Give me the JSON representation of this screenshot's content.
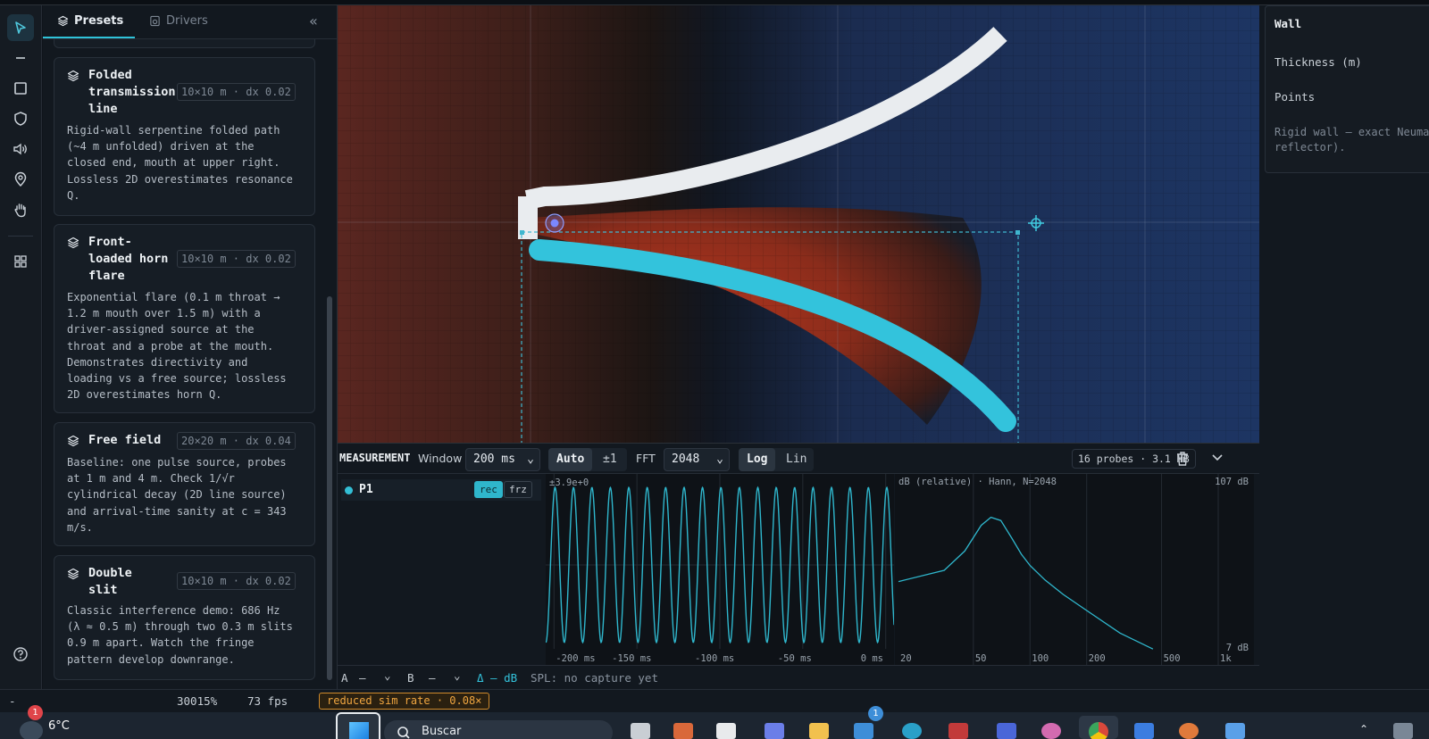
{
  "presets_panel": {
    "tabs": [
      {
        "label": "Presets"
      },
      {
        "label": "Drivers"
      }
    ],
    "collapse_glyph": "«",
    "cards": [
      {
        "name_lines": [
          "Folded",
          "transmission",
          "line"
        ],
        "meta": "10×10 m · dx 0.02",
        "desc_lines": [
          "Rigid-wall serpentine folded path",
          "(~4 m unfolded) driven at the",
          "closed end, mouth at upper right.",
          "Lossless 2D overestimates resonance",
          "Q."
        ]
      },
      {
        "name_lines": [
          "Front-",
          "loaded horn",
          "flare"
        ],
        "meta": "10×10 m · dx 0.02",
        "desc_lines": [
          "Exponential flare (0.1 m throat →",
          "1.2 m mouth over 1.5 m) with a",
          "driver-assigned source at the",
          "throat and a probe at the mouth.",
          "Demonstrates directivity and",
          "loading vs a free source; lossless",
          "2D overestimates horn Q."
        ]
      },
      {
        "name_lines": [
          "Free field"
        ],
        "meta": "20×20 m · dx 0.04",
        "desc_lines": [
          "Baseline: one pulse source, probes",
          "at 1 m and 4 m. Check 1/√r",
          "cylindrical decay (2D line source)",
          "and arrival-time sanity at c = 343",
          "m/s."
        ]
      },
      {
        "name_lines": [
          "Double",
          "slit"
        ],
        "meta": "10×10 m · dx 0.02",
        "desc_lines": [
          "Classic interference demo: 686 Hz",
          "(λ ≈ 0.5 m) through two 0.3 m slits",
          "0.9 m apart. Watch the fringe",
          "pattern develop downrange."
        ]
      }
    ]
  },
  "tools": [
    "pointer-icon",
    "line-icon",
    "rectangle-icon",
    "shield-icon",
    "speaker-icon",
    "location-pin-icon",
    "hand-icon",
    "grid-icon",
    "help-icon"
  ],
  "inspector": {
    "title": "Wall",
    "thickness_label": "Thickness (m)",
    "points_label": "Points",
    "note_lines": [
      "Rigid wall — exact Neuma",
      "reflector)."
    ]
  },
  "measurement": {
    "title": "MEASUREMENT",
    "window_label": "Window",
    "window_value": "200 ms",
    "auto_label": "Auto",
    "pm1_label": "±1",
    "fft_label": "FFT",
    "fft_value": "2048",
    "log_label": "Log",
    "lin_label": "Lin",
    "probes_info": "16 probes · 3.1 MB",
    "probe": {
      "name": "P1",
      "rec": "rec",
      "frz": "frz",
      "color": "#33bfd6"
    },
    "waveform": {
      "amp_label": "±3.9e+0",
      "x_ticks": [
        "-200 ms",
        "-150 ms",
        "-100 ms",
        "-50 ms",
        "0 ms"
      ],
      "cycles": 19
    },
    "spectrum": {
      "header": "dB (relative)  ·  Hann, N=2048",
      "ymax_label": "107 dB",
      "ymin_label": "7 dB",
      "x_ticks": [
        "20",
        "50",
        "100",
        "200",
        "500",
        "1k"
      ]
    },
    "footer": {
      "a_label": "A",
      "a_value": "—",
      "b_label": "B",
      "b_value": "—",
      "delta_label": "Δ — dB",
      "spl_text": "SPL: no capture yet"
    }
  },
  "chart_data": [
    {
      "type": "line",
      "title": "",
      "xlabel": "",
      "ylabel": "",
      "x_ticks": [
        "-200 ms",
        "-150 ms",
        "-100 ms",
        "-50 ms",
        "0 ms"
      ],
      "xlim_ms": [
        -205,
        5
      ],
      "ylim": [
        -3.9,
        3.9
      ],
      "series": [
        {
          "frequency_hz": 90,
          "amplitude": 3.6
        }
      ]
    },
    {
      "type": "line",
      "title": "",
      "scale_x": "log",
      "x_ticks": [
        "20",
        "50",
        "100",
        "200",
        "500",
        "1k"
      ],
      "ylim_db": [
        7,
        107
      ],
      "x": [
        20,
        35,
        45,
        55,
        62,
        70,
        80,
        90,
        100,
        120,
        150,
        200,
        300,
        450
      ],
      "y": [
        50,
        57,
        69,
        85,
        90,
        88,
        77,
        67,
        60,
        51,
        42,
        32,
        18,
        8
      ]
    }
  ],
  "status": {
    "left": "-",
    "zoom": "30015%",
    "fps": "73 fps",
    "reduced": "reduced sim rate · 0.08×"
  },
  "taskbar": {
    "weather": "6°C",
    "weather_badge": "1",
    "search_placeholder": "Buscar",
    "app_badge": "1"
  }
}
